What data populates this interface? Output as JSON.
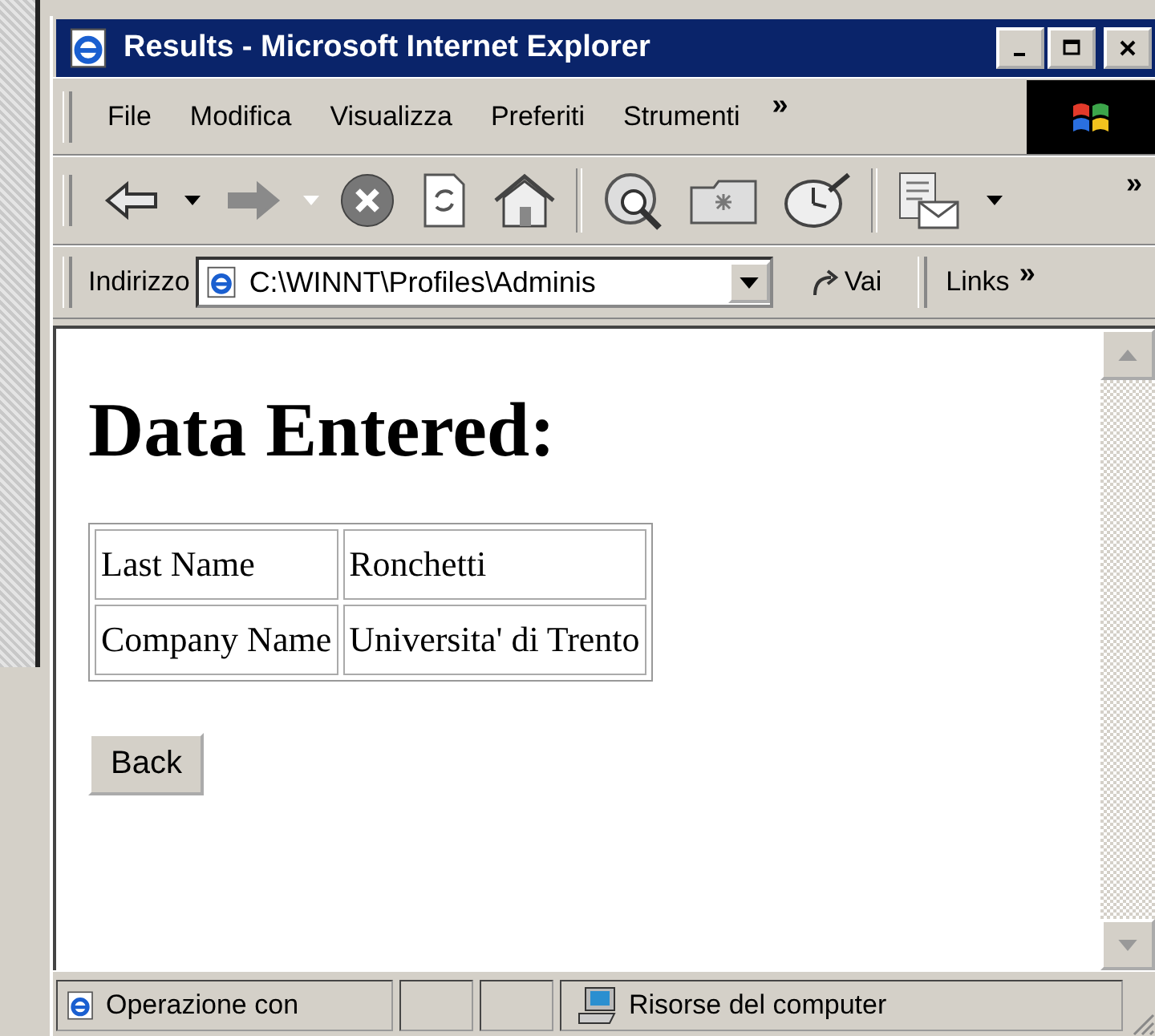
{
  "window": {
    "title": "Results - Microsoft Internet Explorer"
  },
  "menu": {
    "items": [
      "File",
      "Modifica",
      "Visualizza",
      "Preferiti",
      "Strumenti"
    ],
    "more": "»"
  },
  "toolbar": {
    "more": "»",
    "back_disabled": false,
    "forward_disabled": true
  },
  "address_bar": {
    "label": "Indirizzo",
    "value": "C:\\WINNT\\Profiles\\Adminis",
    "go": "Vai",
    "links": "Links",
    "links_more": "»"
  },
  "page": {
    "heading": "Data Entered:",
    "rows": [
      {
        "label": "Last Name",
        "value": "Ronchetti"
      },
      {
        "label": "Company Name",
        "value": "Universita' di Trento"
      }
    ],
    "button": "Back"
  },
  "status_bar": {
    "message": "Operazione con",
    "zone": "Risorse del computer"
  }
}
